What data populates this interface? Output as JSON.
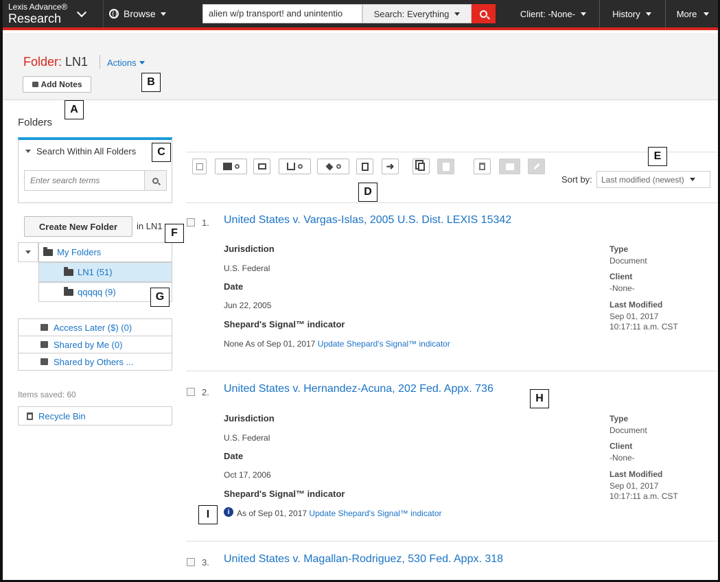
{
  "header": {
    "brand_line1": "Lexis Advance®",
    "brand_line2": "Research",
    "browse_label": "Browse",
    "search_value": "alien w/p transport! and unintentio",
    "search_scope": "Search: Everything",
    "client_label": "Client: -None-",
    "history_label": "History",
    "more_label": "More"
  },
  "folder_header": {
    "prefix": "Folder:",
    "name": "LN1",
    "actions_label": "Actions",
    "add_notes_label": "Add Notes"
  },
  "callouts": [
    "A",
    "B",
    "C",
    "D",
    "E",
    "F",
    "G",
    "H",
    "I"
  ],
  "sidebar": {
    "title": "Folders",
    "search_header": "Search Within All Folders",
    "search_placeholder": "Enter search terms",
    "create_folder_label": "Create New Folder",
    "create_in_label": "in LN1",
    "tree": [
      {
        "label": "My Folders"
      },
      {
        "label": "LN1 (51)"
      },
      {
        "label": "qqqqq (9)"
      }
    ],
    "lists": [
      {
        "label": "Access Later ($) (0)"
      },
      {
        "label": "Shared by Me (0)"
      },
      {
        "label": "Shared by Others ..."
      }
    ],
    "items_saved": "Items saved: 60",
    "recycle_label": "Recycle Bin"
  },
  "toolbar": {
    "icons": [
      "select-all-checkbox-icon",
      "print-icon",
      "email-icon",
      "download-icon",
      "dropbox-icon",
      "save-document-icon",
      "move-arrow-icon",
      "copy-icon",
      "annotate-icon",
      "delete-icon",
      "share-icon",
      "tools-icon"
    ],
    "sort_label": "Sort by:",
    "sort_value": "Last modified (newest)"
  },
  "results": [
    {
      "num": "1.",
      "title": "United States v. Vargas-Islas, 2005 U.S. Dist. LEXIS 15342",
      "jurisdiction_label": "Jurisdiction",
      "jurisdiction": "U.S. Federal",
      "date_label": "Date",
      "date": "Jun 22, 2005",
      "signal_label": "Shepard's Signal™ indicator",
      "signal_prefix": "None As of Sep 01, 2017",
      "signal_link": "Update Shepard's Signal™ indicator",
      "type_label": "Type",
      "type": "Document",
      "client_label": "Client",
      "client": "-None-",
      "modified_label": "Last Modified",
      "modified_date": "Sep 01, 2017",
      "modified_time": "10:17:11 a.m. CST"
    },
    {
      "num": "2.",
      "title": "United States v. Hernandez-Acuna, 202 Fed. Appx. 736",
      "jurisdiction_label": "Jurisdiction",
      "jurisdiction": "U.S. Federal",
      "date_label": "Date",
      "date": "Oct 17, 2006",
      "signal_label": "Shepard's Signal™ indicator",
      "signal_prefix": "As of Sep 01, 2017",
      "signal_link": "Update Shepard's Signal™ indicator",
      "type_label": "Type",
      "type": "Document",
      "client_label": "Client",
      "client": "-None-",
      "modified_label": "Last Modified",
      "modified_date": "Sep 01, 2017",
      "modified_time": "10:17:11 a.m. CST"
    },
    {
      "num": "3.",
      "title": "United States v. Magallan-Rodriguez, 530 Fed. Appx. 318"
    }
  ],
  "colors": {
    "accent_red": "#d9251c",
    "link_blue": "#1a73c5",
    "panel_blue": "#1a9bd7",
    "topbar_bg": "#2b2b2b"
  }
}
